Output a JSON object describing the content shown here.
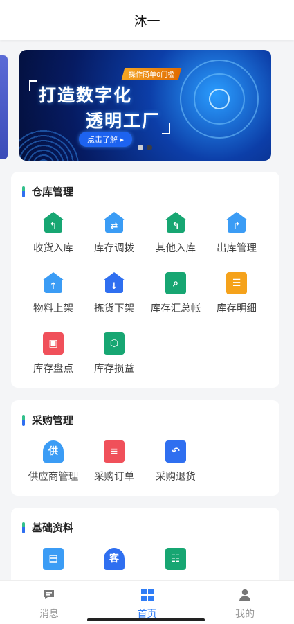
{
  "header": {
    "title": "沐一"
  },
  "banner": {
    "tag": "操作简单0门槛",
    "line1": "打造数字化",
    "line2": "透明工厂",
    "cta": "点击了解 ▸",
    "page_index": 1,
    "page_count": 2
  },
  "sections": [
    {
      "title": "仓库管理",
      "items": [
        {
          "label": "收货入库",
          "icon": "home-back-icon",
          "color": "#17a672"
        },
        {
          "label": "库存调拨",
          "icon": "home-transfer-icon",
          "color": "#3b9cf5"
        },
        {
          "label": "其他入库",
          "icon": "home-back-icon",
          "color": "#17a672"
        },
        {
          "label": "出库管理",
          "icon": "home-forward-icon",
          "color": "#3b9cf5"
        },
        {
          "label": "物料上架",
          "icon": "home-up-icon",
          "color": "#3b9cf5"
        },
        {
          "label": "拣货下架",
          "icon": "home-down-icon",
          "color": "#2f6ff0"
        },
        {
          "label": "库存汇总帐",
          "icon": "ledger-search-icon",
          "color": "#17a672"
        },
        {
          "label": "库存明细",
          "icon": "detail-list-icon",
          "color": "#f5a21b"
        },
        {
          "label": "库存盘点",
          "icon": "inventory-bag-icon",
          "color": "#f0505a"
        },
        {
          "label": "库存损益",
          "icon": "box-ledger-icon",
          "color": "#17a672"
        }
      ]
    },
    {
      "title": "采购管理",
      "items": [
        {
          "label": "供应商管理",
          "icon": "supplier-icon",
          "badge": "供",
          "color": "#3b9cf5"
        },
        {
          "label": "采购订单",
          "icon": "purchase-order-icon",
          "color": "#f0505a"
        },
        {
          "label": "采购退货",
          "icon": "purchase-return-icon",
          "color": "#2f6ff0"
        }
      ]
    },
    {
      "title": "基础资料",
      "items": [
        {
          "label": "",
          "icon": "material-box-icon",
          "color": "#3b9cf5"
        },
        {
          "label": "",
          "icon": "customer-icon",
          "badge": "客",
          "color": "#2f6ff0"
        },
        {
          "label": "",
          "icon": "checklist-icon",
          "color": "#17a672"
        }
      ]
    }
  ],
  "tabbar": {
    "items": [
      {
        "label": "消息",
        "icon": "message-icon",
        "active": false
      },
      {
        "label": "首页",
        "icon": "home-grid-icon",
        "active": true
      },
      {
        "label": "我的",
        "icon": "user-icon",
        "active": false
      }
    ],
    "active_color": "#2f7df6",
    "inactive_color": "#999999"
  }
}
